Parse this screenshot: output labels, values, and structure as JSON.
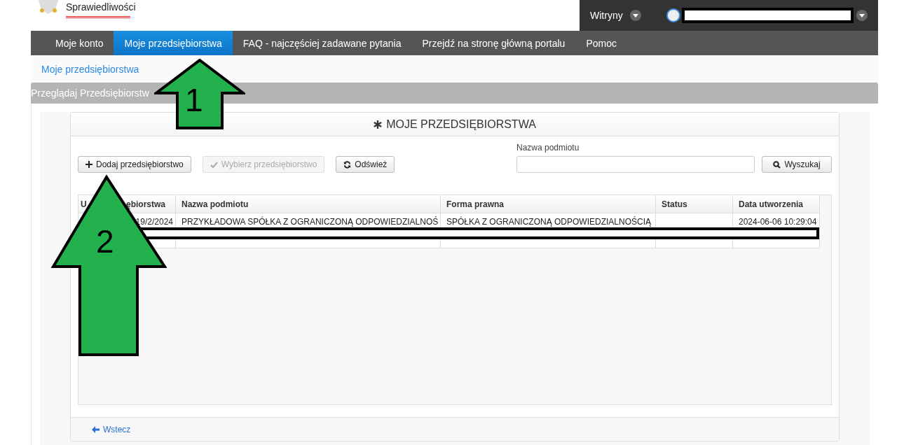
{
  "logo": {
    "text": "Sprawiedliwości"
  },
  "top_bar": {
    "sites_label": "Witryny"
  },
  "nav": [
    {
      "label": "Moje konto",
      "selected": false
    },
    {
      "label": "Moje przedsiębiorstwa",
      "selected": true
    },
    {
      "label": "FAQ - najczęściej zadawane pytania",
      "selected": false
    },
    {
      "label": "Przejdź na stronę główną portalu",
      "selected": false
    },
    {
      "label": "Pomoc",
      "selected": false
    }
  ],
  "breadcrumb": "Moje przedsiębiorstwa",
  "panel_title": "Przeglądaj Przedsiębiorstw",
  "card": {
    "title": "MOJE PRZEDSIĘBIORSTWA",
    "buttons": [
      {
        "kind": "add",
        "label": "Dodaj przedsiębiorstwo",
        "disabled": false
      },
      {
        "kind": "select",
        "label": "Wybierz przedsiębiorstwo",
        "disabled": true
      },
      {
        "kind": "refresh",
        "label": "Odśwież",
        "disabled": false
      }
    ],
    "search": {
      "label": "Nazwa podmiotu",
      "button": "Wyszukaj"
    },
    "table": {
      "columns": [
        {
          "parts": [
            "U",
            "ębiorstwa"
          ]
        },
        "Nazwa podmiotu",
        "Forma prawna",
        "Status",
        "Data utworzenia"
      ],
      "rows": [
        [
          "19/2/2024",
          "PRZYKŁADOWA SPÓŁKA Z OGRANICZONĄ ODPOWIEDZIALNOŚ",
          "SPÓŁKA Z OGRANICZONĄ ODPOWIEDZIALNOŚCIĄ",
          "",
          "2024-06-06 10:29:04"
        ]
      ]
    },
    "back": "Wstecz"
  },
  "annotations": [
    {
      "label": "1"
    },
    {
      "label": "2"
    }
  ]
}
